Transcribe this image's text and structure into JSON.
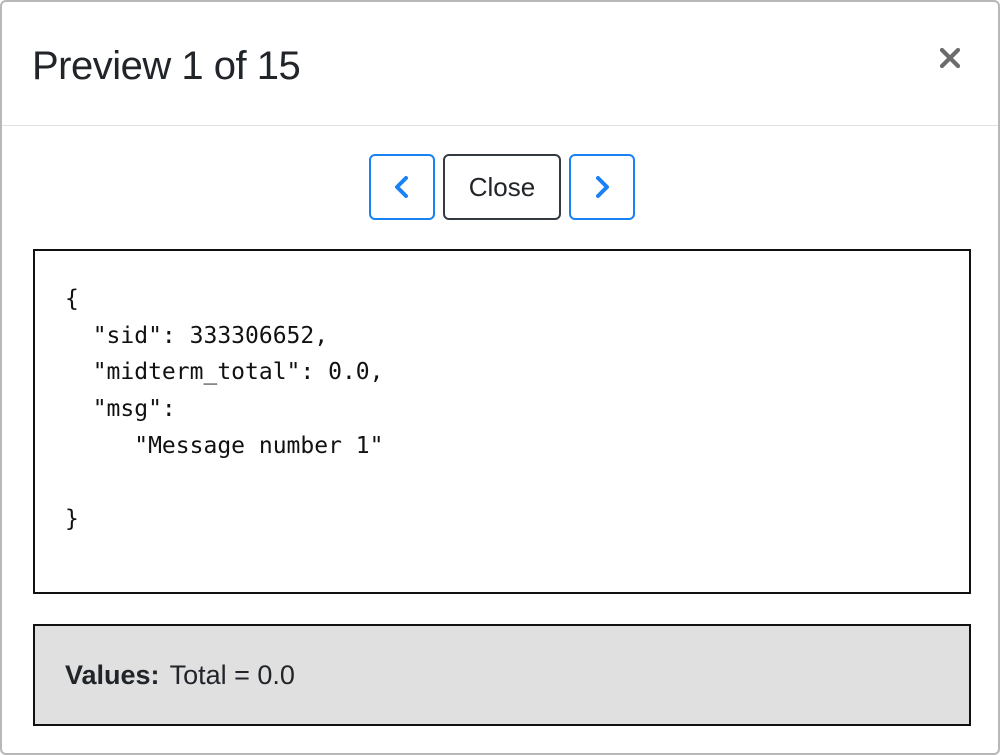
{
  "modal": {
    "title": "Preview 1 of 15",
    "close_icon": "times-icon"
  },
  "nav": {
    "prev_icon": "chevron-left-icon",
    "close_label": "Close",
    "next_icon": "chevron-right-icon",
    "accent_color": "#1a82f7"
  },
  "record": {
    "json_text": "{\n  \"sid\": 333306652,\n  \"midterm_total\": 0.0,\n  \"msg\":\n     \"Message number 1\"\n\n}"
  },
  "values": {
    "label": "Values:",
    "text": "Total = 0.0",
    "background_color": "#e0e0e0"
  }
}
